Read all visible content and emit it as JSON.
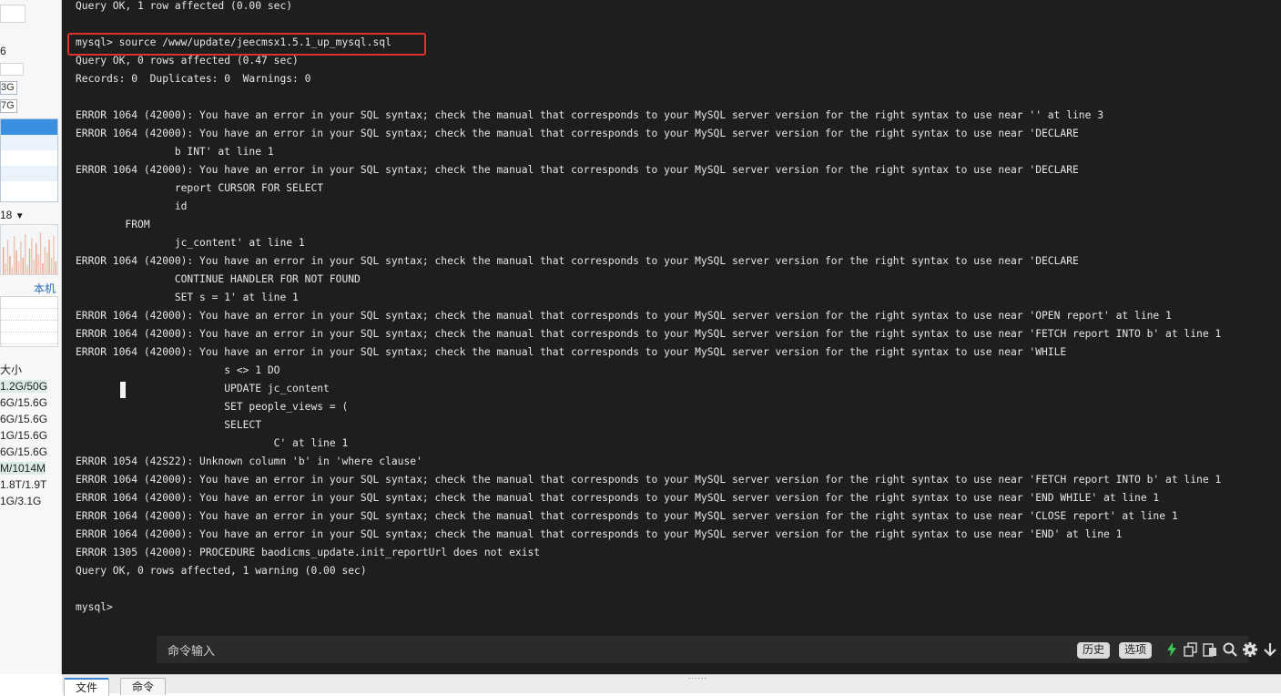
{
  "sidebar": {
    "count_value": "6",
    "mem_tags": [
      "3G",
      "7G"
    ],
    "chart_label": "18",
    "local_label": "本机",
    "disk_header": "大小",
    "disk_rows": [
      "1.2G/50G",
      "6G/15.6G",
      "6G/15.6G",
      "1G/15.6G",
      "6G/15.6G",
      "M/1014M",
      "1.8T/1.9T",
      "1G/3.1G"
    ],
    "disk_highlight_suffixes": [
      "1.2G/50G",
      "6G",
      "1014M"
    ]
  },
  "terminal": {
    "lines": [
      "Query OK, 1 row affected (0.00 sec)",
      "",
      "mysql> source /www/update/jeecmsx1.5.1_up_mysql.sql",
      "Query OK, 0 rows affected (0.47 sec)",
      "Records: 0  Duplicates: 0  Warnings: 0",
      "",
      "ERROR 1064 (42000): You have an error in your SQL syntax; check the manual that corresponds to your MySQL server version for the right syntax to use near '' at line 3",
      "ERROR 1064 (42000): You have an error in your SQL syntax; check the manual that corresponds to your MySQL server version for the right syntax to use near 'DECLARE",
      "                b INT' at line 1",
      "ERROR 1064 (42000): You have an error in your SQL syntax; check the manual that corresponds to your MySQL server version for the right syntax to use near 'DECLARE",
      "                report CURSOR FOR SELECT",
      "                id",
      "        FROM",
      "                jc_content' at line 1",
      "ERROR 1064 (42000): You have an error in your SQL syntax; check the manual that corresponds to your MySQL server version for the right syntax to use near 'DECLARE",
      "                CONTINUE HANDLER FOR NOT FOUND",
      "                SET s = 1' at line 1",
      "ERROR 1064 (42000): You have an error in your SQL syntax; check the manual that corresponds to your MySQL server version for the right syntax to use near 'OPEN report' at line 1",
      "ERROR 1064 (42000): You have an error in your SQL syntax; check the manual that corresponds to your MySQL server version for the right syntax to use near 'FETCH report INTO b' at line 1",
      "ERROR 1064 (42000): You have an error in your SQL syntax; check the manual that corresponds to your MySQL server version for the right syntax to use near 'WHILE",
      "                        s <> 1 DO",
      "                        UPDATE jc_content",
      "                        SET people_views = (",
      "                        SELECT",
      "                                C' at line 1",
      "ERROR 1054 (42S22): Unknown column 'b' in 'where clause'",
      "ERROR 1064 (42000): You have an error in your SQL syntax; check the manual that corresponds to your MySQL server version for the right syntax to use near 'FETCH report INTO b' at line 1",
      "ERROR 1064 (42000): You have an error in your SQL syntax; check the manual that corresponds to your MySQL server version for the right syntax to use near 'END WHILE' at line 1",
      "ERROR 1064 (42000): You have an error in your SQL syntax; check the manual that corresponds to your MySQL server version for the right syntax to use near 'CLOSE report' at line 1",
      "ERROR 1064 (42000): You have an error in your SQL syntax; check the manual that corresponds to your MySQL server version for the right syntax to use near 'END' at line 1",
      "ERROR 1305 (42000): PROCEDURE baodicms_update.init_reportUrl does not exist",
      "Query OK, 0 rows affected, 1 warning (0.00 sec)",
      "",
      "mysql>"
    ],
    "highlight_color": "#e0312d",
    "background": "#1e1e1e"
  },
  "command_bar": {
    "placeholder": "命令输入",
    "history_label": "历史",
    "options_label": "选项",
    "icons": [
      "lightning-icon",
      "copy-icon",
      "paste-icon",
      "search-icon",
      "gear-icon",
      "download-arrow-icon",
      "window-icon"
    ]
  },
  "bottom_tabs": {
    "files_label": "文件",
    "commands_label": "命令",
    "resize_dots": "......"
  }
}
